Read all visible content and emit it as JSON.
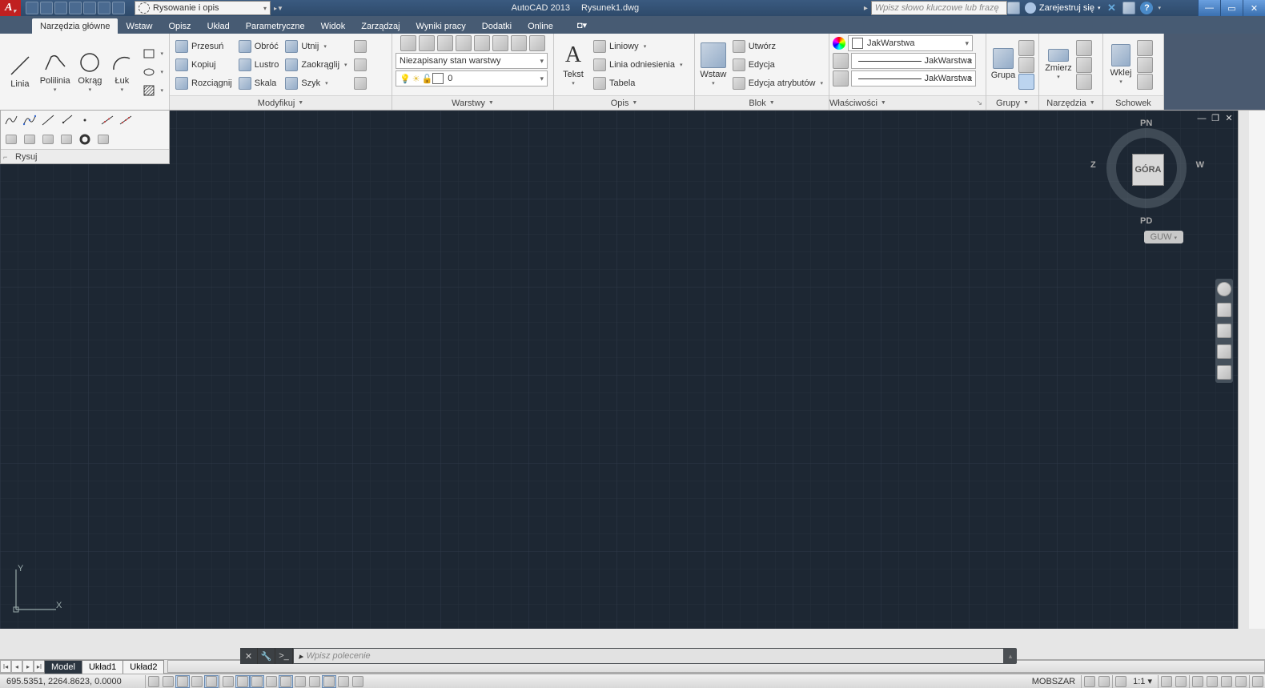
{
  "title": {
    "app": "AutoCAD 2013",
    "file": "Rysunek1.dwg",
    "workspace": "Rysowanie i opis",
    "search_ph": "Wpisz słowo kluczowe lub frazę",
    "signin": "Zarejestruj się"
  },
  "tabs": [
    "Narzędzia główne",
    "Wstaw",
    "Opisz",
    "Układ",
    "Parametryczne",
    "Widok",
    "Zarządzaj",
    "Wyniki pracy",
    "Dodatki",
    "Online"
  ],
  "draw": {
    "line": "Linia",
    "polyline": "Polilinia",
    "circle": "Okrąg",
    "arc": "Łuk",
    "panel": "Rysuj"
  },
  "modify": {
    "move": "Przesuń",
    "copy": "Kopiuj",
    "stretch": "Rozciągnij",
    "rotate": "Obróć",
    "mirror": "Lustro",
    "scale": "Skala",
    "trim": "Utnij",
    "fillet": "Zaokrąglij",
    "array": "Szyk",
    "panel": "Modyfikuj"
  },
  "layers": {
    "state": "Niezapisany stan warstwy",
    "current": "0",
    "panel": "Warstwy"
  },
  "annot": {
    "text": "Tekst",
    "linear": "Liniowy",
    "leader": "Linia odniesienia",
    "table": "Tabela",
    "panel": "Opis"
  },
  "block": {
    "insert": "Wstaw",
    "create": "Utwórz",
    "edit": "Edycja",
    "attr": "Edycja atrybutów",
    "panel": "Blok"
  },
  "props": {
    "bylayer": "JakWarstwa",
    "panel": "Właściwości"
  },
  "groups": {
    "group": "Grupa",
    "panel": "Grupy"
  },
  "utils": {
    "measure": "Zmierz",
    "panel": "Narzędzia"
  },
  "clip": {
    "paste": "Wklej",
    "panel": "Schowek"
  },
  "viewcube": {
    "top": "GÓRA",
    "n": "PN",
    "s": "PD",
    "w": "Z",
    "e": "W",
    "guw": "GUW"
  },
  "cmd": {
    "prompt_ph": "Wpisz polecenie"
  },
  "layouts": {
    "model": "Model",
    "l1": "Układ1",
    "l2": "Układ2"
  },
  "status": {
    "coords": "695.5351, 2264.8623, 0.0000",
    "mob": "MOBSZAR",
    "scale": "1:1"
  }
}
